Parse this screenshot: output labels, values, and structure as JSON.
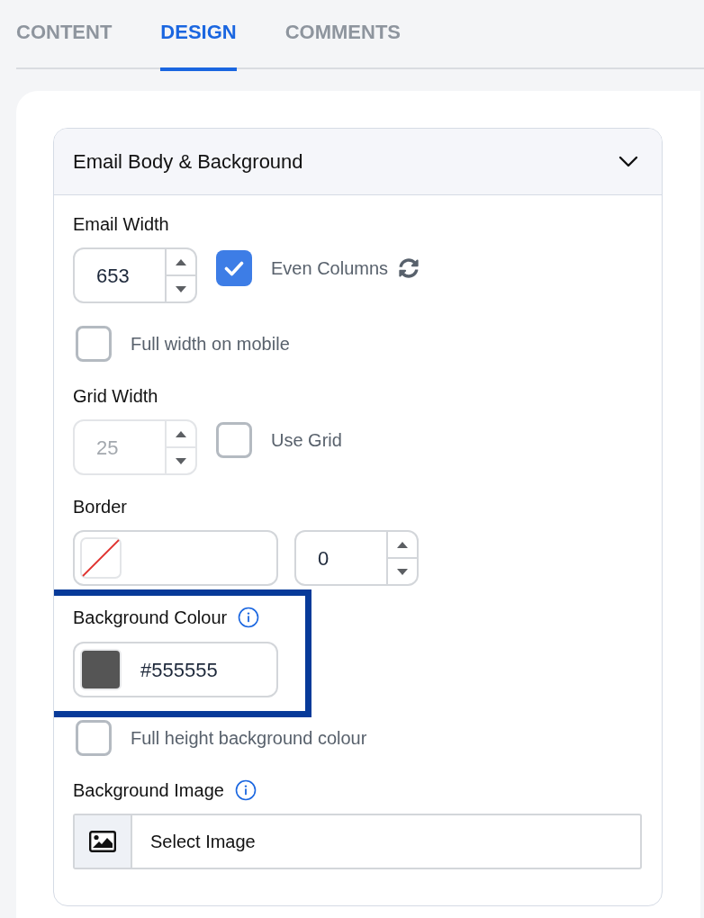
{
  "tabs": [
    {
      "label": "CONTENT",
      "selected": false
    },
    {
      "label": "DESIGN",
      "selected": true
    },
    {
      "label": "COMMENTS",
      "selected": false
    }
  ],
  "section": {
    "title": "Email Body & Background",
    "expanded": true,
    "items": [
      {
        "kind": "label",
        "text": "Email Width",
        "info": false
      },
      {
        "kind": "number",
        "value": "653",
        "disabled": false,
        "check": {
          "label": "Even Columns",
          "checked": true,
          "sync": true
        }
      },
      {
        "kind": "checkbox",
        "label": "Full width on mobile",
        "checked": false
      },
      {
        "kind": "label",
        "text": "Grid Width",
        "info": false
      },
      {
        "kind": "number",
        "value": "25",
        "disabled": true,
        "check": {
          "label": "Use Grid",
          "checked": false,
          "sync": false
        }
      },
      {
        "kind": "label",
        "text": "Border",
        "info": false
      },
      {
        "kind": "border",
        "value": "0"
      },
      {
        "kind": "group",
        "highlighted": true,
        "items": [
          {
            "kind": "label",
            "text": "Background Colour",
            "info": true
          },
          {
            "kind": "color",
            "value": "#555555",
            "color": "#555555"
          }
        ]
      },
      {
        "kind": "checkbox",
        "label": "Full height background colour",
        "checked": false
      },
      {
        "kind": "label",
        "text": "Background Image",
        "info": true
      },
      {
        "kind": "image",
        "label": "Select Image"
      }
    ]
  }
}
